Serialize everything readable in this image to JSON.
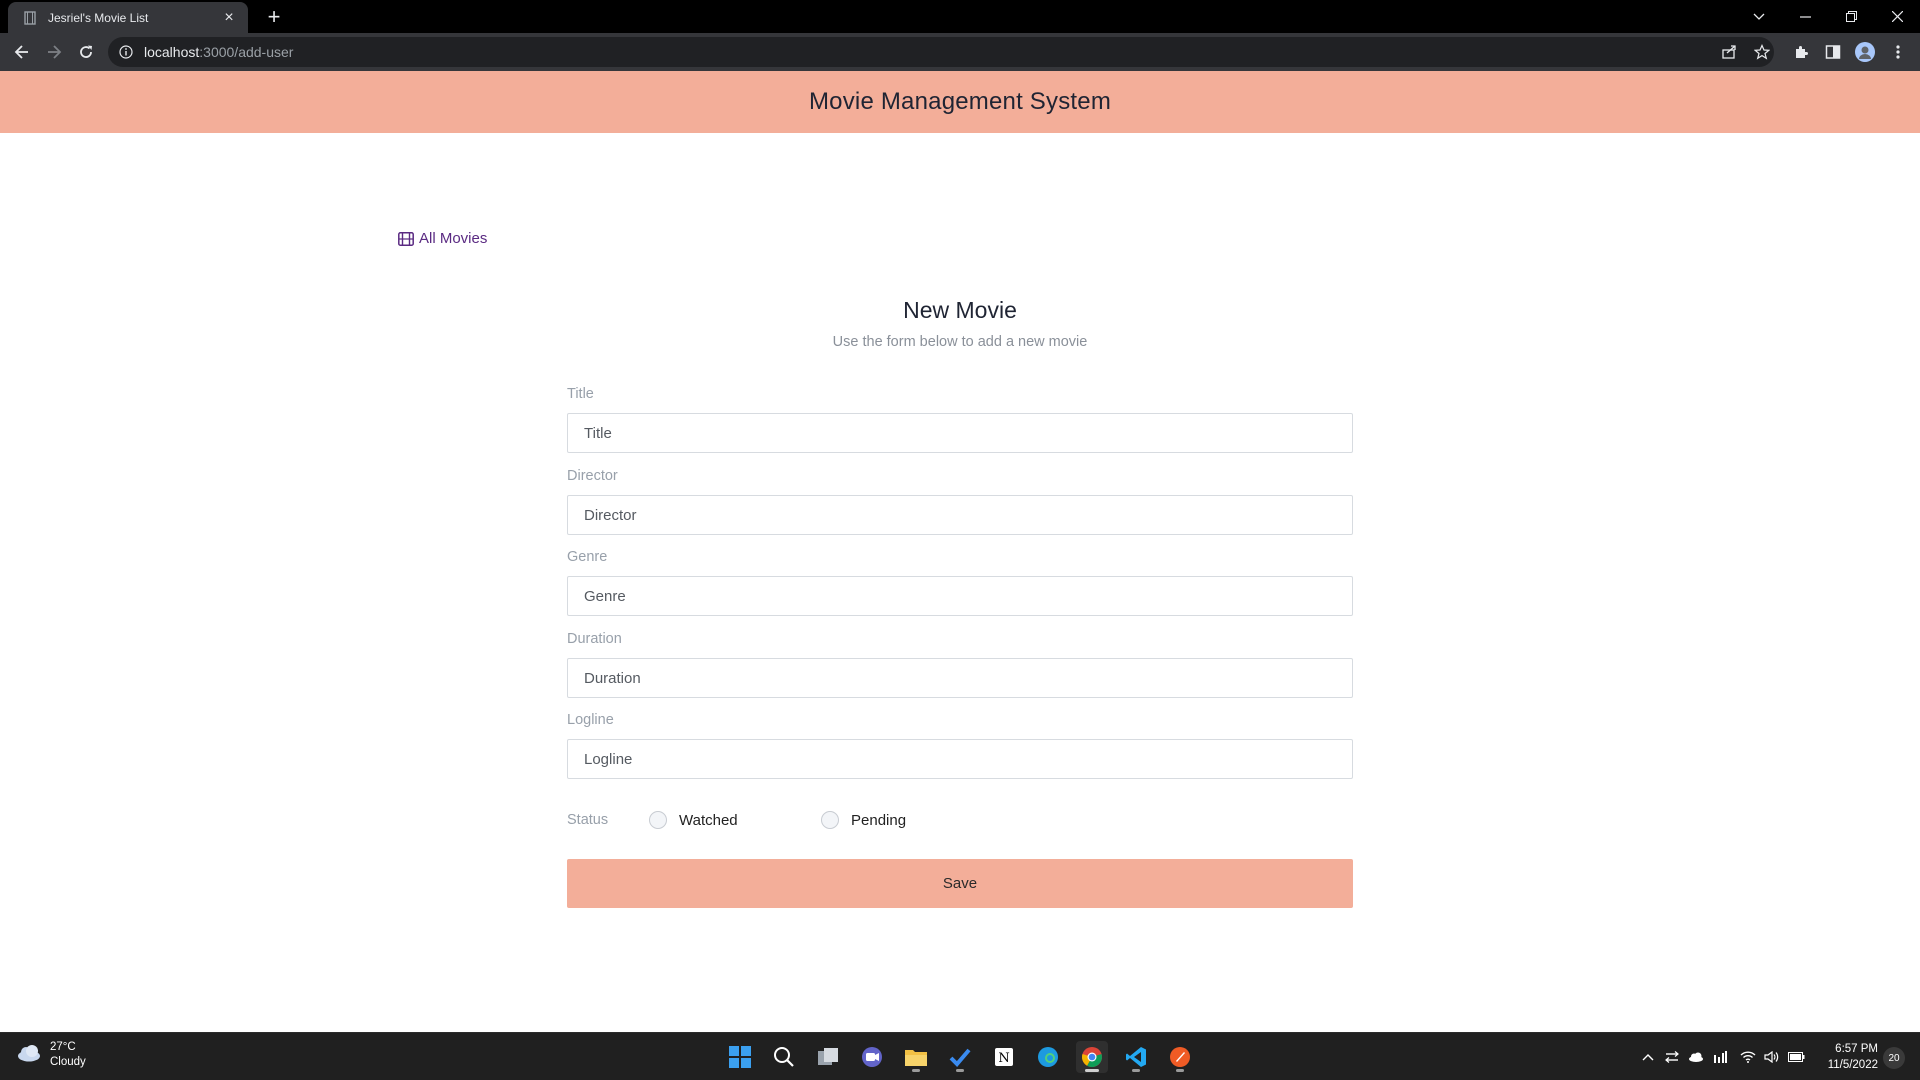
{
  "browser": {
    "tab_title": "Jesriel's Movie List",
    "tab_close": "×",
    "new_tab": "+",
    "url_host": "localhost",
    "url_path": ":3000/add-user"
  },
  "app": {
    "title": "Movie Management System",
    "accent_color": "#f3ae99",
    "link_color": "#5a2a82"
  },
  "nav": {
    "all_movies_label": "All Movies",
    "all_movies_icon": "film-icon"
  },
  "form": {
    "heading": "New Movie",
    "subheading": "Use the form below to add a new movie",
    "fields": [
      {
        "label": "Title",
        "placeholder": "Title",
        "value": ""
      },
      {
        "label": "Director",
        "placeholder": "Director",
        "value": ""
      },
      {
        "label": "Genre",
        "placeholder": "Genre",
        "value": ""
      },
      {
        "label": "Duration",
        "placeholder": "Duration",
        "value": ""
      },
      {
        "label": "Logline",
        "placeholder": "Logline",
        "value": ""
      }
    ],
    "status": {
      "label": "Status",
      "options": [
        "Watched",
        "Pending"
      ],
      "selected": null
    },
    "save_label": "Save"
  },
  "taskbar": {
    "weather_temp": "27°C",
    "weather_desc": "Cloudy",
    "time": "6:57 PM",
    "date": "11/5/2022",
    "notification_count": "20",
    "apps": [
      "start",
      "search",
      "task-view",
      "chat",
      "file-explorer",
      "todo",
      "notion",
      "edge",
      "chrome",
      "vscode",
      "postman"
    ]
  }
}
